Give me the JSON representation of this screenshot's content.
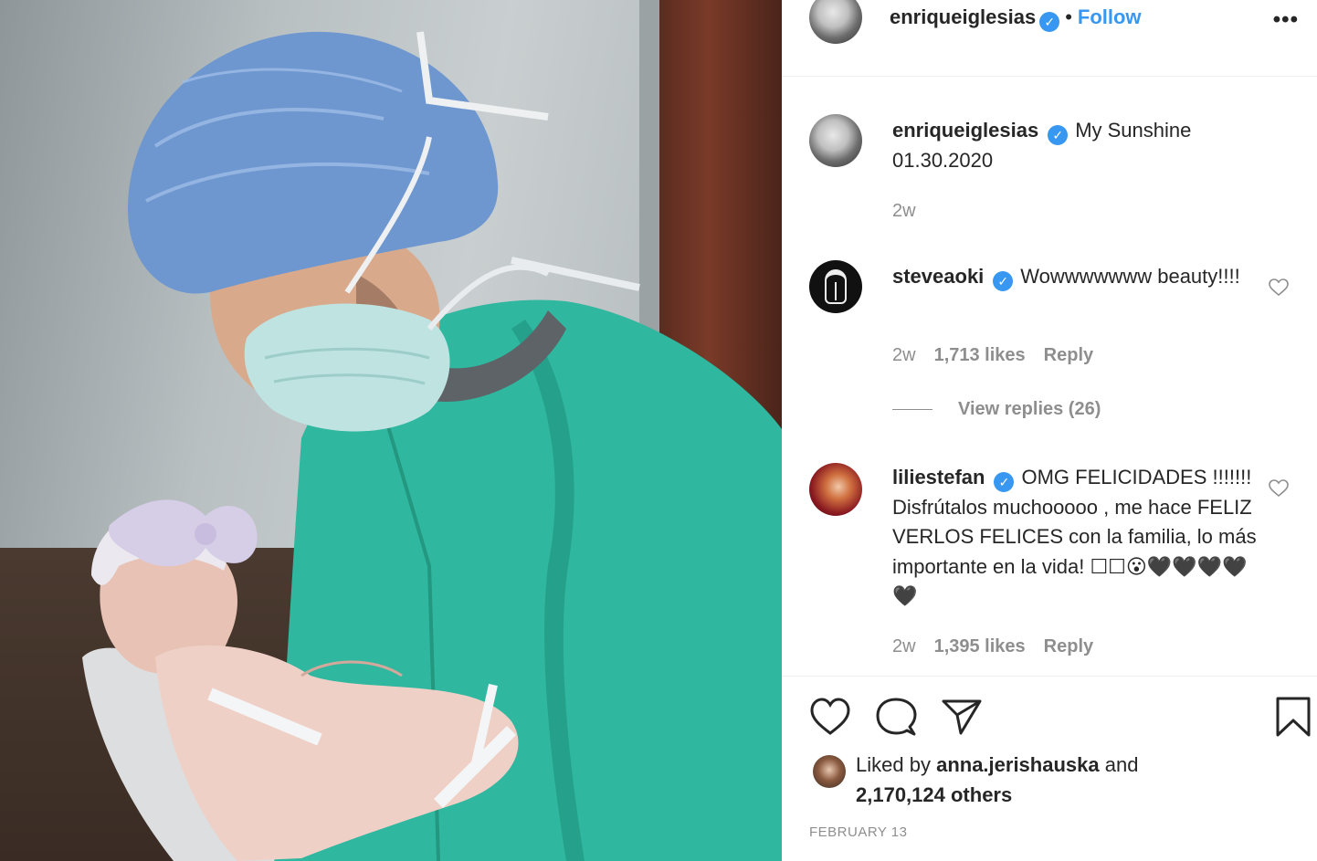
{
  "post": {
    "author": "enriqueiglesias",
    "follow_label": "Follow",
    "dot": "•",
    "more_label": "•••",
    "caption_line1": "My Sunshine",
    "caption_line2": "01.30.2020",
    "caption_age": "2w"
  },
  "comments": [
    {
      "user": "steveaoki",
      "text": "Wowwwwwww beauty!!!!",
      "age": "2w",
      "likes": "1,713 likes",
      "reply_label": "Reply",
      "view_replies": "View replies (26)"
    },
    {
      "user": "liliestefan",
      "text": "OMG FELICIDADES !!!!!!! Disfrútalos muchooooo , me hace FELIZ VERLOS FELICES con la familia, lo más importante en la vida! ☐☐😮🖤🖤🖤🖤🖤",
      "age": "2w",
      "likes": "1,395 likes",
      "reply_label": "Reply"
    }
  ],
  "likes": {
    "prefix": "Liked by",
    "user": "anna.jerishauska",
    "and": "and",
    "count": "2,170,124 others"
  },
  "date": "FEBRUARY 13",
  "colors": {
    "link_blue": "#3897f0",
    "muted": "#8e8e8e",
    "text": "#262626",
    "scrub_green": "#2fb79f",
    "cap_blue": "#6e97d0"
  },
  "icons": [
    "verified-badge-icon",
    "more-options-icon",
    "heart-outline-icon",
    "comment-bubble-icon",
    "share-plane-icon",
    "bookmark-icon"
  ]
}
